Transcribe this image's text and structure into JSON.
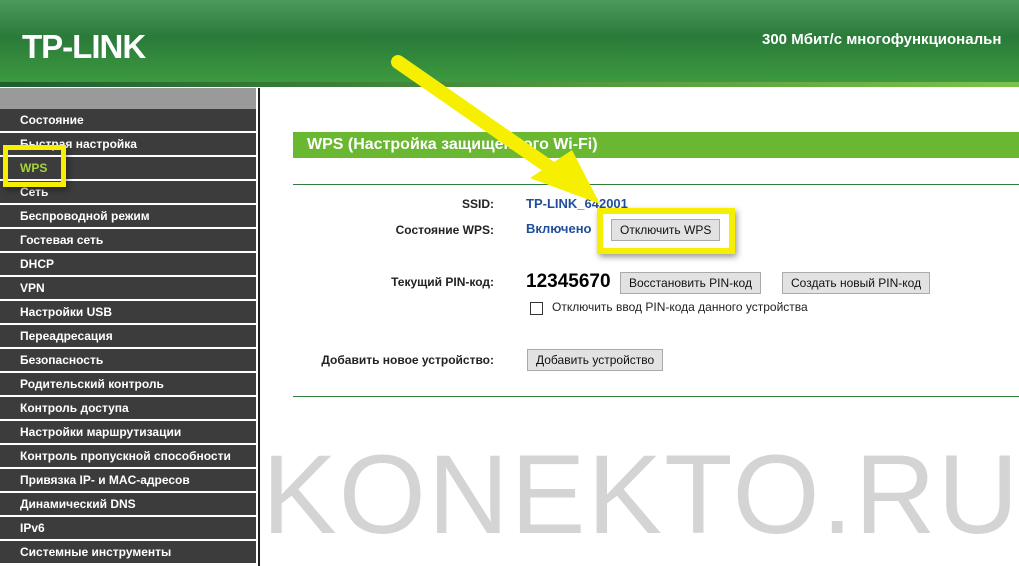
{
  "header": {
    "logo": "TP-LINK",
    "title": "300 Мбит/с многофункциональн"
  },
  "sidebar": {
    "items": [
      {
        "label": "Состояние"
      },
      {
        "label": "Быстрая настройка"
      },
      {
        "label": "WPS",
        "active": true
      },
      {
        "label": "Сеть"
      },
      {
        "label": "Беспроводной режим"
      },
      {
        "label": "Гостевая сеть"
      },
      {
        "label": "DHCP"
      },
      {
        "label": "VPN"
      },
      {
        "label": "Настройки USB"
      },
      {
        "label": "Переадресация"
      },
      {
        "label": "Безопасность"
      },
      {
        "label": "Родительский контроль"
      },
      {
        "label": "Контроль доступа"
      },
      {
        "label": "Настройки маршрутизации"
      },
      {
        "label": "Контроль пропускной способности"
      },
      {
        "label": "Привязка IP- и MAC-адресов"
      },
      {
        "label": "Динамический DNS"
      },
      {
        "label": "IPv6"
      },
      {
        "label": "Системные инструменты"
      }
    ]
  },
  "main": {
    "section_title": "WPS (Настройка защищенного Wi-Fi)",
    "ssid_label": "SSID:",
    "ssid_value": "TP-LINK_642001",
    "wps_state_label": "Состояние WPS:",
    "wps_state_value": "Включено",
    "disable_wps_button": "Отключить WPS",
    "pin_label": "Текущий PIN-код:",
    "pin_value": "12345670",
    "restore_pin_button": "Восстановить PIN-код",
    "new_pin_button": "Создать новый PIN-код",
    "disable_pin_checkbox": "Отключить ввод PIN-кода данного устройства",
    "disable_pin_checked": false,
    "add_device_label": "Добавить новое устройство:",
    "add_device_button": "Добавить устройство"
  },
  "watermark": "KONEKTO.RU",
  "colors": {
    "accent": "#6ab832",
    "highlight": "#f6f000",
    "header": "#2a7a3a"
  }
}
